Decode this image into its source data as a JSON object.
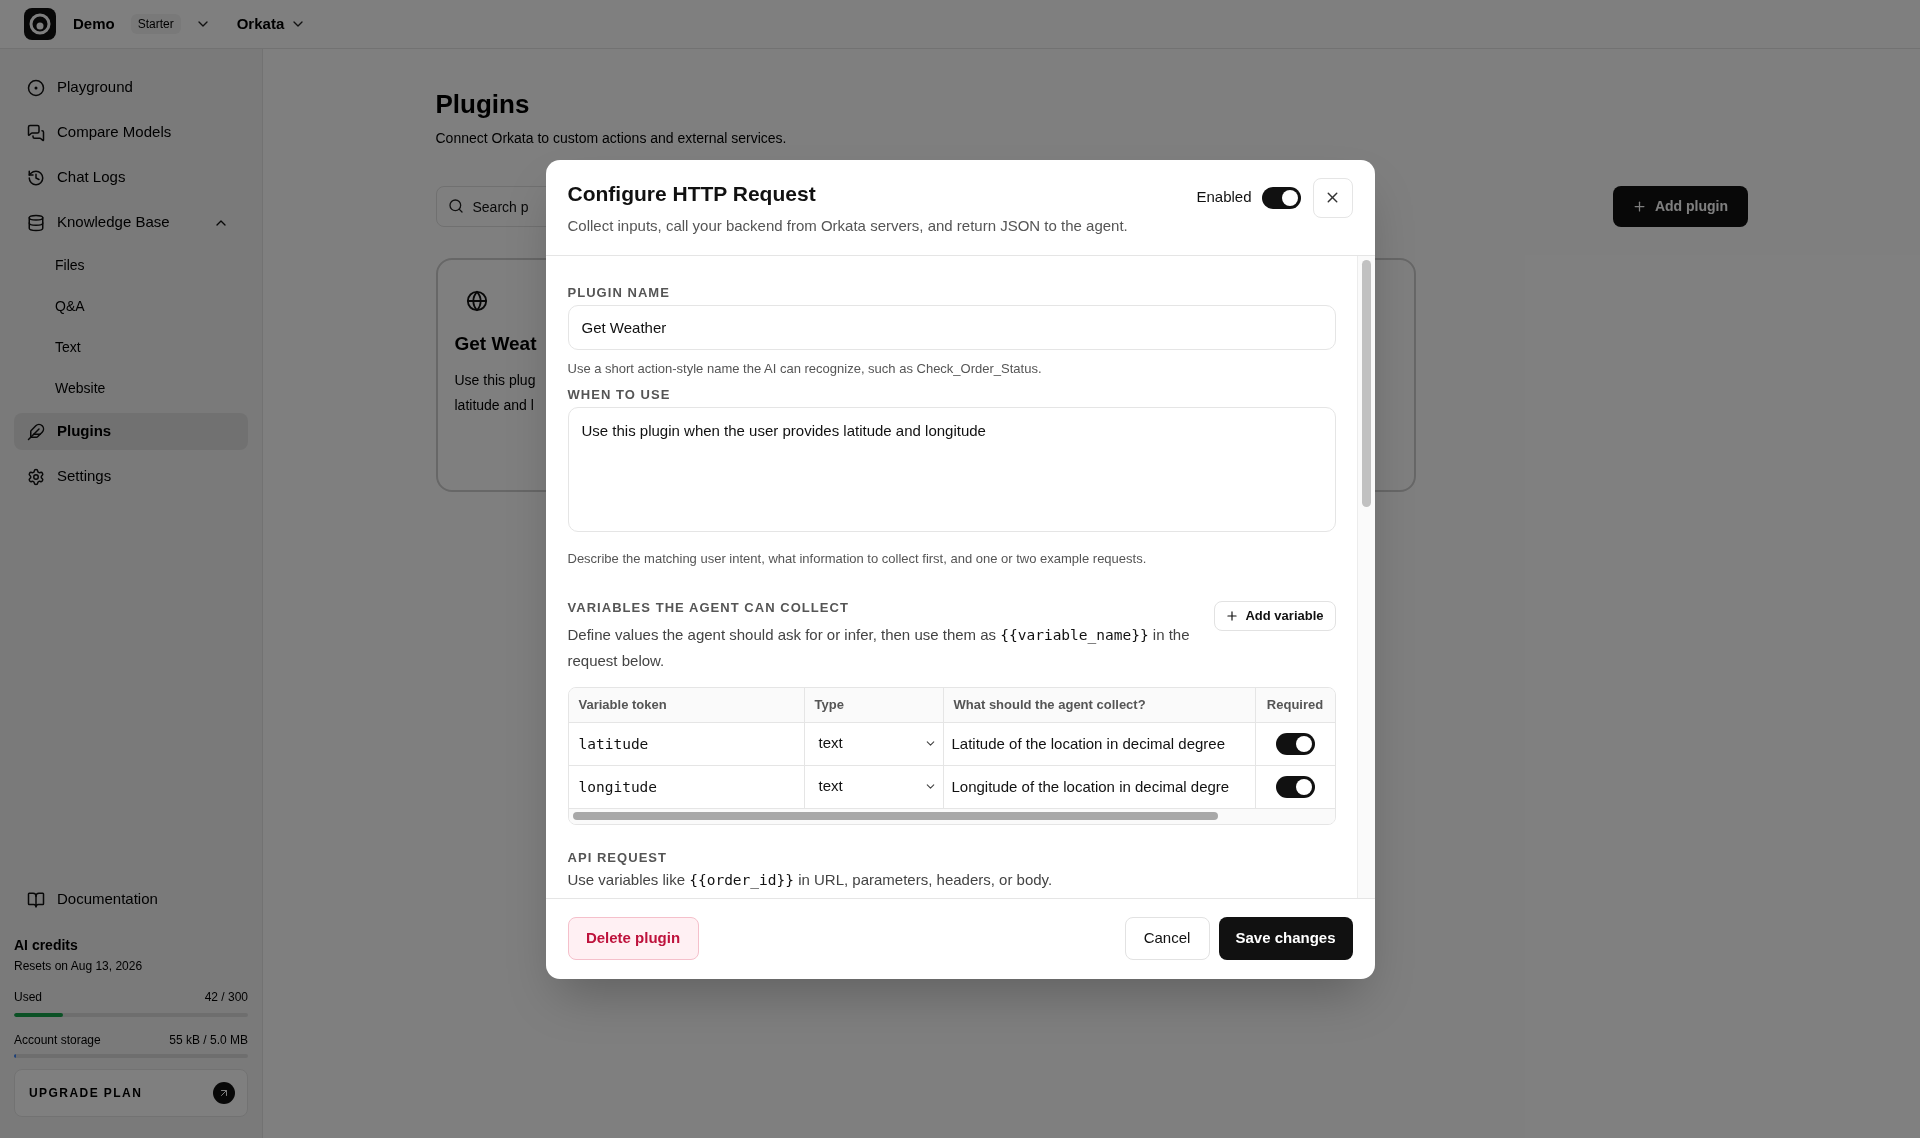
{
  "topbar": {
    "workspace": "Demo",
    "plan": "Starter",
    "project": "Orkata"
  },
  "sidebar": {
    "nav": [
      {
        "label": "Playground",
        "selected": false
      },
      {
        "label": "Compare Models",
        "selected": false
      },
      {
        "label": "Chat Logs",
        "selected": false
      },
      {
        "label": "Knowledge Base",
        "selected": false,
        "expanded": true,
        "children": [
          {
            "label": "Files",
            "selected": false
          },
          {
            "label": "Q&A",
            "selected": false
          },
          {
            "label": "Text",
            "selected": false
          },
          {
            "label": "Website",
            "selected": false
          }
        ]
      },
      {
        "label": "Plugins",
        "selected": true
      },
      {
        "label": "Settings",
        "selected": false
      }
    ],
    "documentation": "Documentation",
    "credits": {
      "title": "AI credits",
      "reset": "Resets on Aug 13, 2026",
      "label": "Used",
      "value": "42 / 300",
      "level": 0.21
    },
    "storage": {
      "label": "Account storage",
      "value": "55 kB / 5.0 MB",
      "level": 0.01
    },
    "upgrade": "UPGRADE PLAN"
  },
  "page": {
    "title": "Plugins",
    "subtitle": "Connect Orkata to custom actions and external services.",
    "search": {
      "placeholder": "Search p"
    },
    "add_button": "Add plugin",
    "cards": [
      {
        "title": "Get Weat",
        "description_lines": [
          "Use this plug",
          "latitude and l"
        ]
      }
    ]
  },
  "dialog": {
    "title": "Configure HTTP Request",
    "subtitle": "Collect inputs, call your backend from Orkata servers, and return JSON to the agent.",
    "enabled": {
      "label": "Enabled",
      "on": true
    },
    "sections": [
      {
        "kind": "input",
        "label": "PLUGIN NAME",
        "value": "Get Weather",
        "help": "Use a short action-style name the AI can recognize, such as Check_Order_Status."
      },
      {
        "kind": "textarea",
        "label": "WHEN TO USE",
        "value": "Use this plugin when the user provides latitude and longitude",
        "help": "Describe the matching user intent, what information to collect first, and one or two example requests."
      },
      {
        "kind": "variables",
        "label": "VARIABLES THE AGENT CAN COLLECT",
        "description": {
          "before": "Define values the agent should ask for or infer, then use them as",
          "code": "{{variable_name}}",
          "after": "in the request below."
        },
        "add_button": "Add variable",
        "table": {
          "columns": [
            "Variable token",
            "Type",
            "What should the agent collect?",
            "Required"
          ],
          "rows": [
            {
              "token": "latitude",
              "type": "text",
              "description": "Latitude of the location in decimal degree",
              "required": true
            },
            {
              "token": "longitude",
              "type": "text",
              "description": "Longitude of the location in decimal degre",
              "required": true
            }
          ]
        }
      },
      {
        "kind": "api",
        "label": "API REQUEST",
        "description": {
          "before": "Use variables like",
          "code": "{{order_id}}",
          "after": "in URL, parameters, headers, or body."
        }
      }
    ],
    "footer": {
      "delete": "Delete plugin",
      "cancel": "Cancel",
      "save": "Save changes"
    }
  }
}
